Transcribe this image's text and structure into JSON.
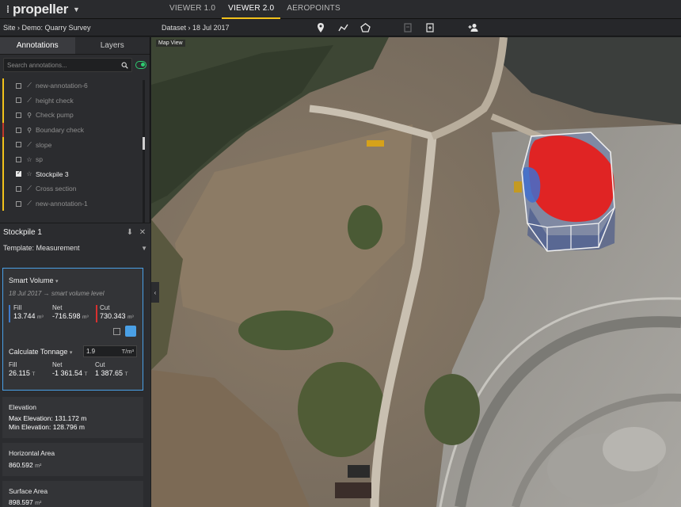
{
  "app": {
    "logo_text": "propeller",
    "view_tabs": [
      {
        "label": "VIEWER 1.0",
        "active": false
      },
      {
        "label": "VIEWER 2.0",
        "active": true
      },
      {
        "label": "AEROPOINTS",
        "active": false
      }
    ]
  },
  "subbar": {
    "breadcrumb": "Site › Demo: Quarry Survey",
    "dataset": "Dataset › 18 Jul 2017",
    "tools": [
      "pin-icon",
      "polyline-icon",
      "polygon-icon",
      "export-icon",
      "report-icon",
      "add-user-icon"
    ]
  },
  "sidebar": {
    "tabs": [
      {
        "label": "Annotations",
        "active": true
      },
      {
        "label": "Layers",
        "active": false
      }
    ],
    "search_placeholder": "Search annotations...",
    "annotations": [
      {
        "label": "new-annotation-6",
        "icon": "line",
        "color": "#f2c21b",
        "checked": false
      },
      {
        "label": "height check",
        "icon": "line",
        "color": "#f2c21b",
        "checked": false
      },
      {
        "label": "Check pump",
        "icon": "pin",
        "color": "#f2c21b",
        "checked": false
      },
      {
        "label": "Boundary check",
        "icon": "pin",
        "color": "#c0392b",
        "checked": false
      },
      {
        "label": "slope",
        "icon": "line",
        "color": "#f2c21b",
        "checked": false
      },
      {
        "label": "sp",
        "icon": "star",
        "color": "#f2c21b",
        "checked": false
      },
      {
        "label": "Stockpile 3",
        "icon": "star",
        "color": "#f2c21b",
        "checked": true
      },
      {
        "label": "Cross section",
        "icon": "line",
        "color": "#f2c21b",
        "checked": false
      },
      {
        "label": "new-annotation-1",
        "icon": "line",
        "color": "#f2c21b",
        "checked": false
      }
    ]
  },
  "detail": {
    "title": "Stockpile 1",
    "template": "Template: Measurement",
    "smart_volume": {
      "title": "Smart Volume",
      "subtitle": "18 Jul 2017 → smart volume level",
      "fill_label": "Fill",
      "fill_value": "13.744",
      "fill_unit": "m³",
      "net_label": "Net",
      "net_value": "-716.598",
      "net_unit": "m³",
      "cut_label": "Cut",
      "cut_value": "730.343",
      "cut_unit": "m³"
    },
    "tonnage": {
      "title": "Calculate Tonnage",
      "density": "1.9",
      "density_unit": "T/m³",
      "fill_label": "Fill",
      "fill_value": "26.115",
      "fill_unit": "T",
      "net_label": "Net",
      "net_value": "-1 361.54",
      "net_unit": "T",
      "cut_label": "Cut",
      "cut_value": "1 387.65",
      "cut_unit": "T"
    },
    "elevation": {
      "title": "Elevation",
      "max_label": "Max Elevation:",
      "max_value": "131.172 m",
      "min_label": "Min Elevation:",
      "min_value": "128.796 m"
    },
    "horizontal_area": {
      "title": "Horizontal Area",
      "value": "860.592",
      "unit": "m²"
    },
    "surface_area": {
      "title": "Surface Area",
      "value": "898.597",
      "unit": "m²"
    }
  },
  "map": {
    "label": "Map View",
    "collapse_glyph": "‹"
  }
}
